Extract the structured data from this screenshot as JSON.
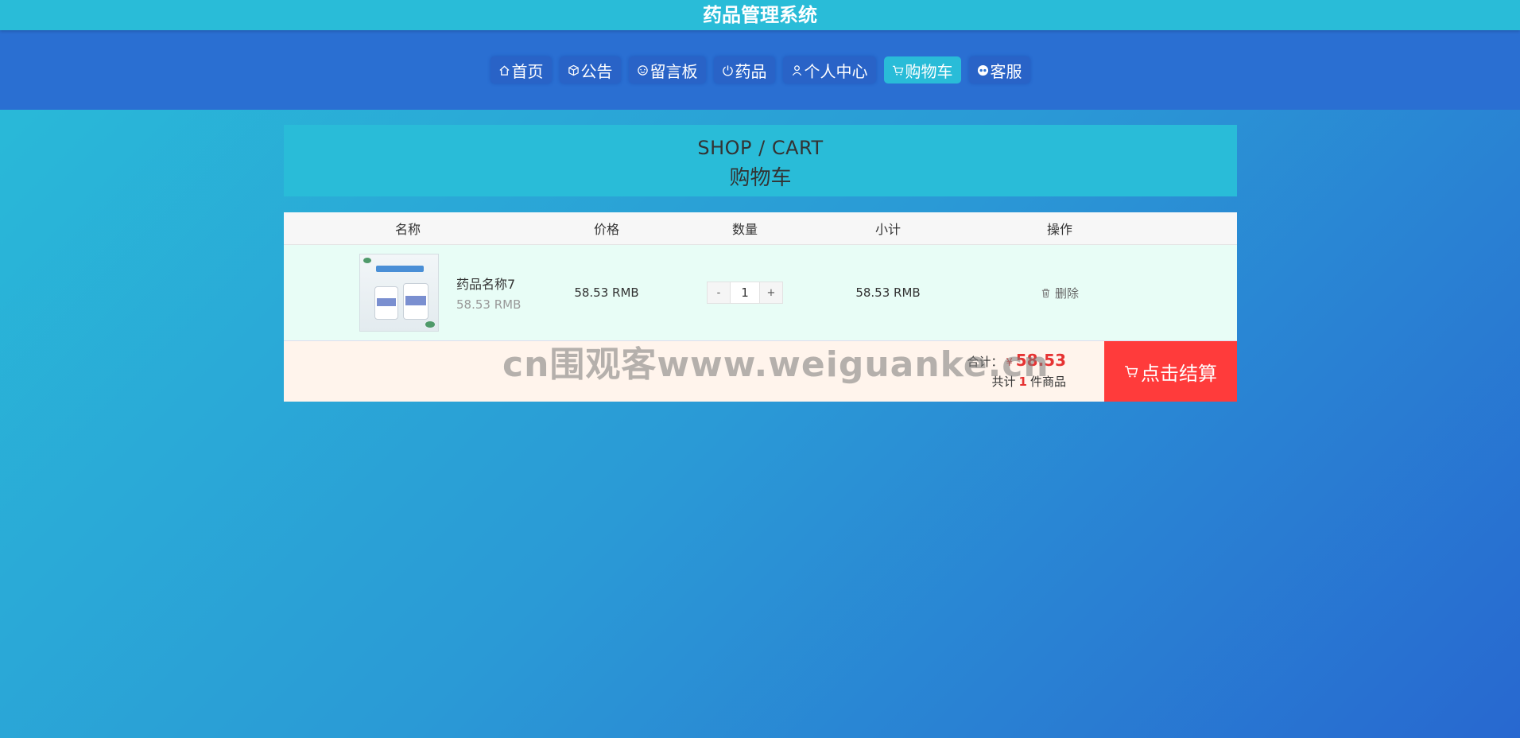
{
  "app": {
    "title": "药品管理系统"
  },
  "nav": {
    "items": [
      {
        "label": "首页",
        "icon": "home-icon"
      },
      {
        "label": "公告",
        "icon": "cube-icon"
      },
      {
        "label": "留言板",
        "icon": "message-icon"
      },
      {
        "label": "药品",
        "icon": "power-icon"
      },
      {
        "label": "个人中心",
        "icon": "user-icon"
      },
      {
        "label": "购物车",
        "icon": "cart-icon",
        "active": true
      },
      {
        "label": "客服",
        "icon": "chat-icon"
      }
    ]
  },
  "banner": {
    "en": "SHOP / CART",
    "zh": "购物车"
  },
  "cart": {
    "columns": [
      "名称",
      "价格",
      "数量",
      "小计",
      "操作"
    ],
    "items": [
      {
        "name": "药品名称7",
        "unit_price": "58.53 RMB",
        "price": "58.53 RMB",
        "quantity": "1",
        "subtotal": "58.53 RMB",
        "delete_label": "删除",
        "minus": "-",
        "plus": "+"
      }
    ],
    "footer": {
      "total_label": "合计：",
      "currency": "¥",
      "total": "58.53",
      "count_prefix": "共计",
      "count": "1",
      "count_suffix": "件商品",
      "checkout_label": "点击结算"
    }
  },
  "watermark": "cn围观客www.weiguanke.cn",
  "colors": {
    "accent": "#29bcd8",
    "nav_bg": "#2a6fd2",
    "checkout": "#ff3b3b",
    "price_red": "#e63333"
  }
}
